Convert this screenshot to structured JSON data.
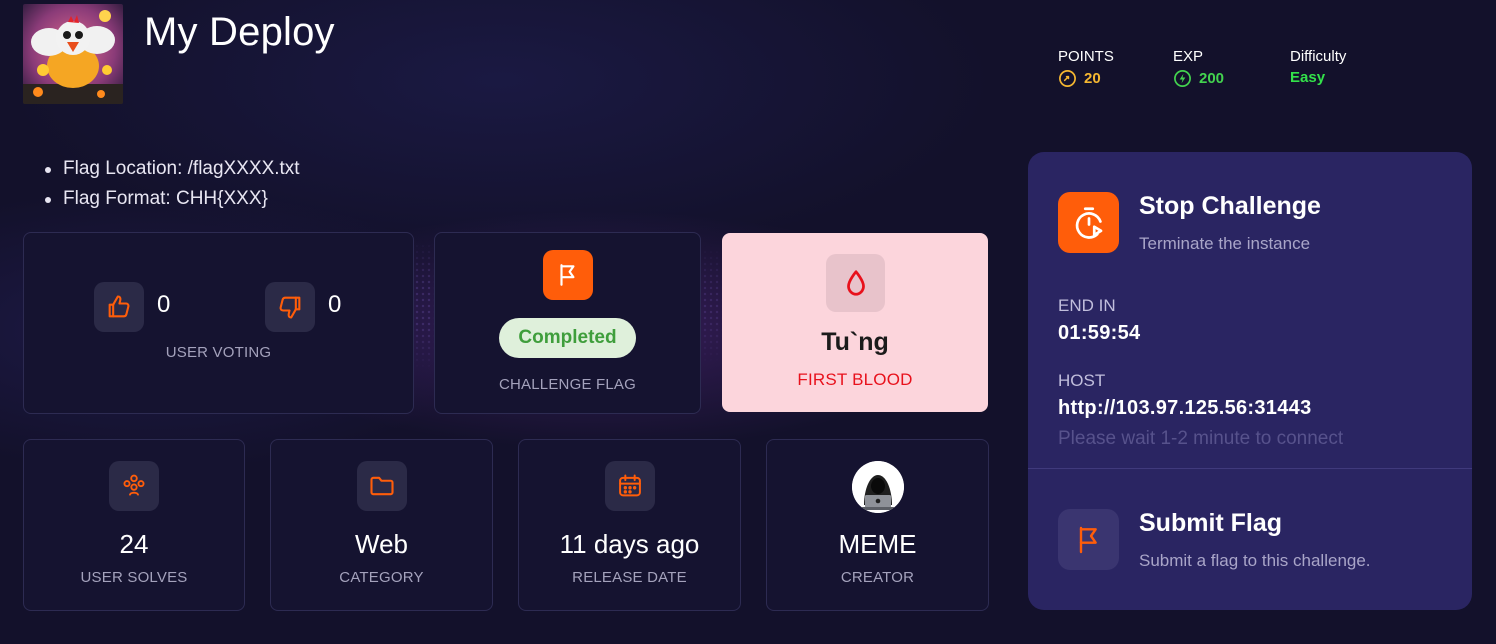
{
  "header": {
    "title": "My Deploy",
    "stats": [
      {
        "label": "POINTS",
        "value": "20",
        "icon": "coin-icon",
        "color": "#f5b731"
      },
      {
        "label": "EXP",
        "value": "200",
        "icon": "exp-icon",
        "color": "#43d34f"
      },
      {
        "label": "Difficulty",
        "value": "Easy",
        "color": "#33e14a"
      }
    ]
  },
  "description": {
    "items": [
      "Flag Location: /flagXXXX.txt",
      "Flag Format: CHH{XXX}"
    ]
  },
  "voting": {
    "likes": "0",
    "dislikes": "0",
    "label": "USER VOTING"
  },
  "flag_card": {
    "status": "Completed",
    "label": "CHALLENGE FLAG"
  },
  "first_blood": {
    "user": "Tu`ng",
    "label": "FIRST BLOOD"
  },
  "info_cards": [
    {
      "value": "24",
      "label": "USER SOLVES",
      "icon": "users-icon"
    },
    {
      "value": "Web",
      "label": "CATEGORY",
      "icon": "folder-icon"
    },
    {
      "value": "11 days ago",
      "label": "RELEASE DATE",
      "icon": "calendar-icon"
    },
    {
      "value": "MEME",
      "label": "CREATOR",
      "icon": "hacker-avatar-icon"
    }
  ],
  "instance": {
    "stop_title": "Stop Challenge",
    "stop_sub": "Terminate the instance",
    "end_label": "END IN",
    "end_value": "01:59:54",
    "host_label": "HOST",
    "host_value": "http://103.97.125.56:31443",
    "hint": "Please wait 1-2 minute to connect",
    "submit_title": "Submit Flag",
    "submit_sub": "Submit a flag to this challenge."
  },
  "colors": {
    "accent": "#ff5d0a",
    "background": "#13112b",
    "panel": "#2a2562",
    "first_blood_bg": "#fcd5dc",
    "first_blood_red": "#e8111c"
  }
}
